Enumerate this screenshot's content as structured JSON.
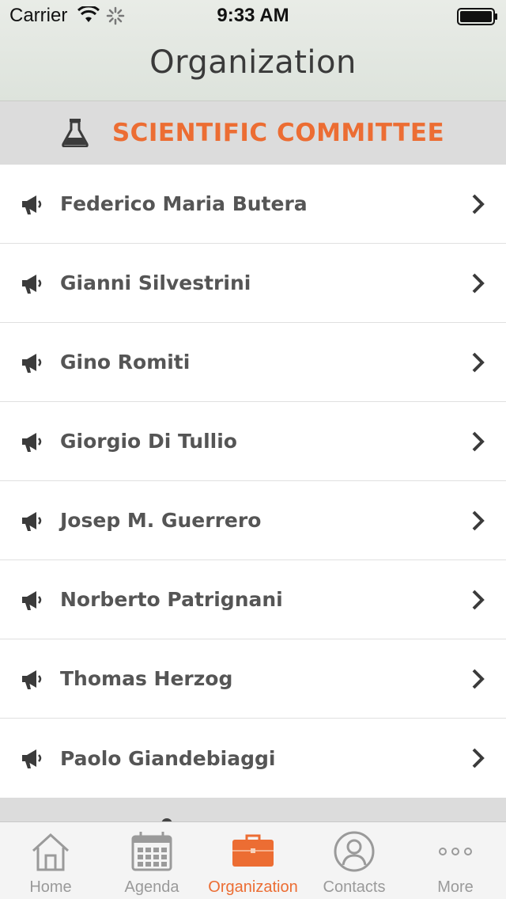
{
  "status_bar": {
    "carrier": "Carrier",
    "time": "9:33 AM"
  },
  "header": {
    "title": "Organization"
  },
  "section": {
    "title": "SCIENTIFIC COMMITTEE",
    "icon": "flask-icon"
  },
  "list": {
    "items": [
      {
        "label": "Federico Maria Butera"
      },
      {
        "label": "Gianni Silvestrini"
      },
      {
        "label": "Gino Romiti"
      },
      {
        "label": "Giorgio Di Tullio"
      },
      {
        "label": "Josep M. Guerrero"
      },
      {
        "label": "Norberto Patrignani"
      },
      {
        "label": "Thomas Herzog"
      },
      {
        "label": "Paolo Giandebiaggi"
      }
    ]
  },
  "tabs": [
    {
      "label": "Home",
      "icon": "home-icon",
      "active": false
    },
    {
      "label": "Agenda",
      "icon": "calendar-icon",
      "active": false
    },
    {
      "label": "Organization",
      "icon": "briefcase-icon",
      "active": true
    },
    {
      "label": "Contacts",
      "icon": "person-icon",
      "active": false
    },
    {
      "label": "More",
      "icon": "more-icon",
      "active": false
    }
  ],
  "colors": {
    "accent": "#ec6d33",
    "text": "#555555",
    "section_bg": "#dcdcdc"
  }
}
